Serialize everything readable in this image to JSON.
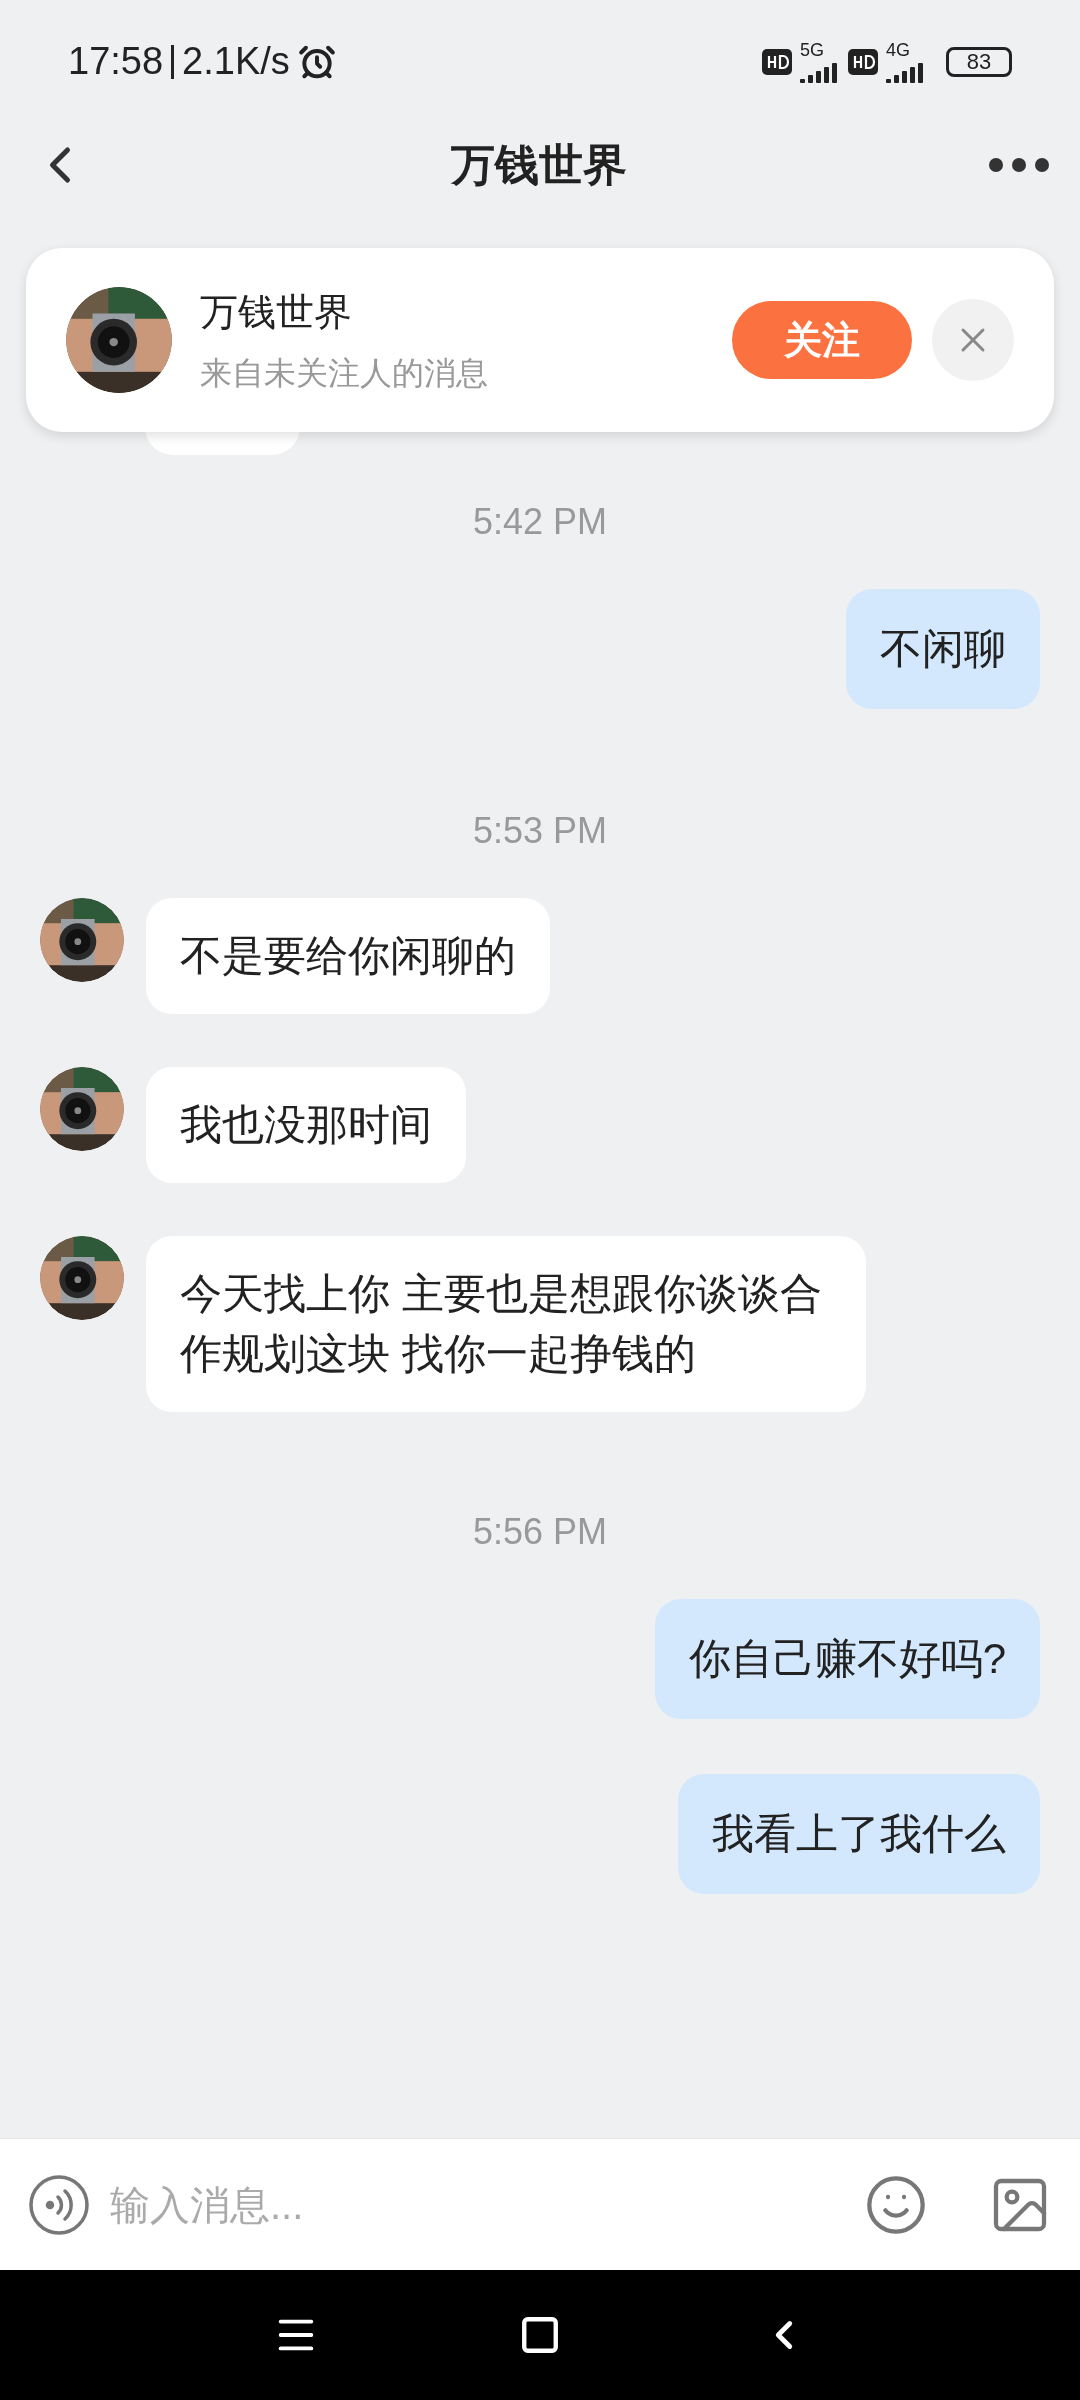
{
  "status_bar": {
    "time": "17:58",
    "speed": "2.1K/s",
    "network_1": "5G",
    "network_2": "4G",
    "battery": "83"
  },
  "header": {
    "title": "万钱世界"
  },
  "follow_banner": {
    "name": "万钱世界",
    "subtitle": "来自未关注人的消息",
    "follow_button": "关注"
  },
  "messages": [
    {
      "kind": "time",
      "text": "5:42 PM"
    },
    {
      "kind": "sent",
      "text": "不闲聊"
    },
    {
      "kind": "time",
      "text": "5:53 PM"
    },
    {
      "kind": "received",
      "text": "不是要给你闲聊的"
    },
    {
      "kind": "received",
      "text": "我也没那时间"
    },
    {
      "kind": "received",
      "text": "今天找上你 主要也是想跟你谈谈合作规划这块 找你一起挣钱的"
    },
    {
      "kind": "time",
      "text": "5:56 PM"
    },
    {
      "kind": "sent",
      "text": "你自己赚不好吗?"
    },
    {
      "kind": "sent",
      "text": "我看上了我什么"
    }
  ],
  "input_bar": {
    "placeholder": "输入消息..."
  }
}
